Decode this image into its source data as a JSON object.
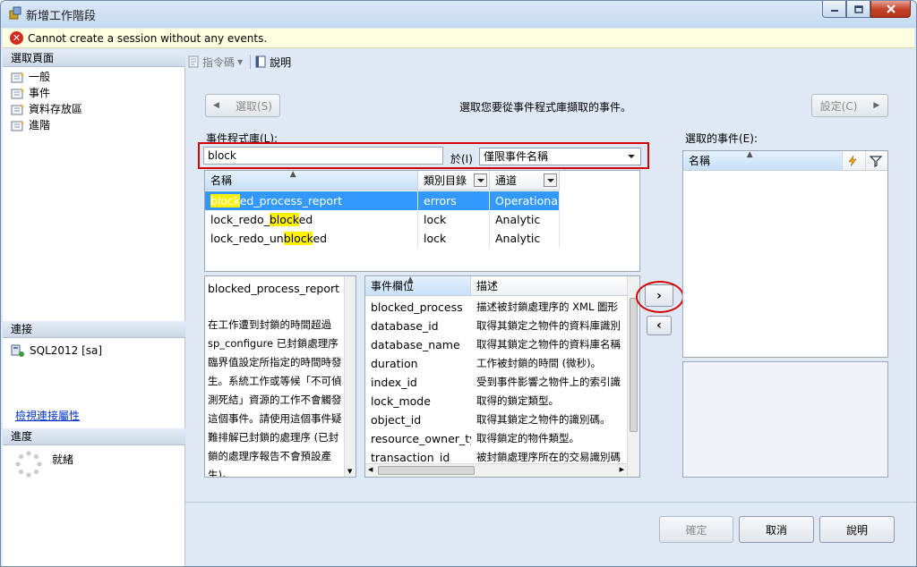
{
  "window": {
    "title": "新增工作階段"
  },
  "error": {
    "message": "Cannot create a session without any events."
  },
  "left_pane": {
    "pages_header": "選取頁面",
    "pages": [
      "一般",
      "事件",
      "資料存放區",
      "進階"
    ],
    "connection_header": "連接",
    "connection_name": "SQL2012 [sa]",
    "view_connection_link": "檢視連接屬性",
    "progress_header": "進度",
    "progress_status": "就緒"
  },
  "toolbar": {
    "script_label": "指令碼",
    "help_label": "說明"
  },
  "nav": {
    "select_button": "選取(S)",
    "configure_button": "設定(C)",
    "instruction": "選取您要從事件程式庫擷取的事件。"
  },
  "library": {
    "label": "事件程式庫(L):",
    "search_value": "block",
    "in_label": "於(I)",
    "filter_selected": "僅限事件名稱",
    "columns": [
      "名稱",
      "類別目錄",
      "通道"
    ],
    "rows": [
      {
        "pre": "",
        "hl": "block",
        "post": "ed_process_report",
        "category": "errors",
        "channel": "Operational"
      },
      {
        "pre": "lock_redo_",
        "hl": "block",
        "post": "ed",
        "category": "lock",
        "channel": "Analytic"
      },
      {
        "pre": "lock_redo_un",
        "hl": "block",
        "post": "ed",
        "category": "lock",
        "channel": "Analytic"
      }
    ]
  },
  "description": {
    "title": "blocked_process_report",
    "body": "在工作遭到封鎖的時間超過 sp_configure 已封鎖處理序臨界值設定所指定的時間時發生。系統工作或等候「不可偵測死結」資源的工作不會觸發這個事件。請使用這個事件疑難排解已封鎖的處理序 (已封鎖的處理序報告不會預設產生)。"
  },
  "fields": {
    "columns": [
      "事件欄位",
      "描述"
    ],
    "rows": [
      {
        "name": "blocked_process",
        "desc": "描述被封鎖處理序的 XML 圖形"
      },
      {
        "name": "database_id",
        "desc": "取得其鎖定之物件的資料庫識別"
      },
      {
        "name": "database_name",
        "desc": "取得其鎖定之物件的資料庫名稱"
      },
      {
        "name": "duration",
        "desc": "工作被封鎖的時間 (微秒)。"
      },
      {
        "name": "index_id",
        "desc": "受到事件影響之物件上的索引識"
      },
      {
        "name": "lock_mode",
        "desc": "取得的鎖定類型。"
      },
      {
        "name": "object_id",
        "desc": "取得其鎖定之物件的識別碼。"
      },
      {
        "name": "resource_owner_ty...",
        "desc": "取得鎖定的物件類型。"
      },
      {
        "name": "transaction_id",
        "desc": "被封鎖處理序所在的交易識別碼"
      }
    ]
  },
  "selected": {
    "label": "選取的事件(E):",
    "name_column": "名稱"
  },
  "footer": {
    "ok": "確定",
    "cancel": "取消",
    "help": "說明"
  }
}
